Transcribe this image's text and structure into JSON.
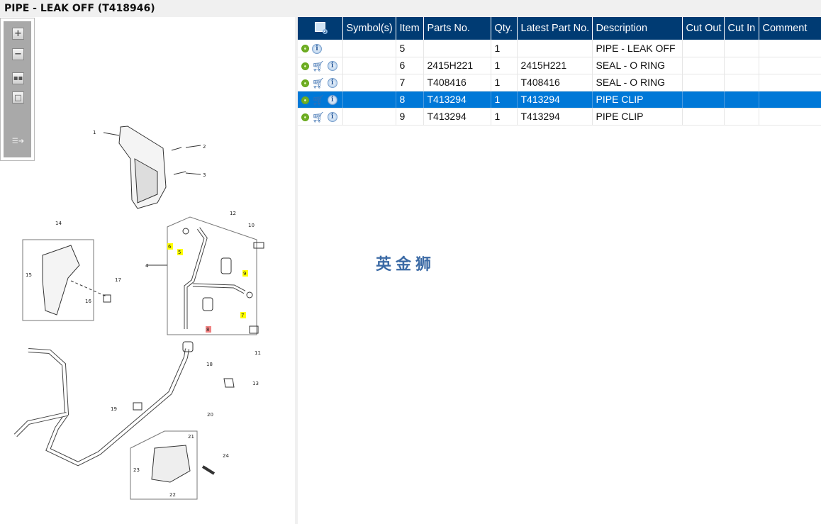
{
  "title": "PIPE - LEAK OFF (T418946)",
  "toolbar": {
    "zoom_in": "zoom-in",
    "zoom_out": "zoom-out",
    "fit": "fit-all",
    "actual": "actual-size",
    "export": "export"
  },
  "table": {
    "headers": [
      "Symbol(s)",
      "Item",
      "Parts No.",
      "Qty.",
      "Latest Part No.",
      "Description",
      "Cut Out",
      "Cut In",
      "Comment"
    ],
    "rows": [
      {
        "cart": false,
        "item": "5",
        "part": "",
        "qty": "1",
        "latest": "",
        "desc": "PIPE - LEAK OFF",
        "selected": false
      },
      {
        "cart": true,
        "item": "6",
        "part": "2415H221",
        "qty": "1",
        "latest": "2415H221",
        "desc": "SEAL - O RING",
        "selected": false
      },
      {
        "cart": true,
        "item": "7",
        "part": "T408416",
        "qty": "1",
        "latest": "T408416",
        "desc": "SEAL - O RING",
        "selected": false
      },
      {
        "cart": true,
        "item": "8",
        "part": "T413294",
        "qty": "1",
        "latest": "T413294",
        "desc": "PIPE CLIP",
        "selected": true
      },
      {
        "cart": true,
        "item": "9",
        "part": "T413294",
        "qty": "1",
        "latest": "T413294",
        "desc": "PIPE CLIP",
        "selected": false
      }
    ]
  },
  "watermark": "英金狮",
  "callouts": [
    "1",
    "2",
    "3",
    "4",
    "5",
    "6",
    "7",
    "8",
    "9",
    "10",
    "11",
    "12",
    "13",
    "14",
    "15",
    "16",
    "17",
    "18",
    "19",
    "20",
    "21",
    "22",
    "23",
    "24"
  ],
  "colors": {
    "header": "#003b73",
    "selected": "#0078d7",
    "highlight": "#ffff00",
    "highlight_selected": "#f08080"
  }
}
